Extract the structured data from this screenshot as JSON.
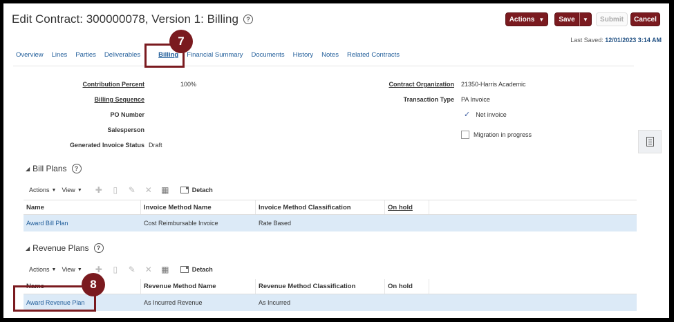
{
  "header": {
    "title": "Edit Contract: 300000078, Version 1: Billing",
    "actions_label": "Actions",
    "save_label": "Save",
    "submit_label": "Submit",
    "cancel_label": "Cancel",
    "last_saved_label": "Last Saved:",
    "last_saved_value": "12/01/2023 3:14 AM"
  },
  "tabs": [
    {
      "label": "Overview"
    },
    {
      "label": "Lines"
    },
    {
      "label": "Parties"
    },
    {
      "label": "Deliverables"
    },
    {
      "label": "Billing"
    },
    {
      "label": "Financial Summary"
    },
    {
      "label": "Documents"
    },
    {
      "label": "History"
    },
    {
      "label": "Notes"
    },
    {
      "label": "Related Contracts"
    }
  ],
  "form": {
    "contribution_percent_label": "Contribution Percent",
    "contribution_percent_value": "100%",
    "billing_sequence_label": "Billing Sequence",
    "po_number_label": "PO Number",
    "salesperson_label": "Salesperson",
    "generated_invoice_status_label": "Generated Invoice Status",
    "generated_invoice_status_value": "Draft",
    "contract_org_label": "Contract Organization",
    "contract_org_value": "21350-Harris Academic",
    "transaction_type_label": "Transaction Type",
    "transaction_type_value": "PA Invoice",
    "net_invoice_label": "Net invoice",
    "migration_label": "Migration in progress"
  },
  "bill_plans": {
    "title": "Bill Plans",
    "toolbar": {
      "actions": "Actions",
      "view": "View",
      "detach": "Detach"
    },
    "columns": [
      "Name",
      "Invoice Method Name",
      "Invoice Method Classification",
      "On hold"
    ],
    "rows": [
      {
        "name": "Award Bill Plan",
        "method": "Cost Reimbursable Invoice",
        "classification": "Rate Based",
        "on_hold": ""
      }
    ]
  },
  "revenue_plans": {
    "title": "Revenue Plans",
    "toolbar": {
      "actions": "Actions",
      "view": "View",
      "detach": "Detach"
    },
    "columns": [
      "Name",
      "Revenue Method Name",
      "Revenue Method Classification",
      "On hold"
    ],
    "rows": [
      {
        "name": "Award Revenue Plan",
        "method": "As Incurred Revenue",
        "classification": "As Incurred",
        "on_hold": ""
      }
    ]
  },
  "callouts": [
    {
      "number": "7"
    },
    {
      "number": "8"
    }
  ],
  "colors": {
    "brand": "#7a1a1f",
    "link": "#1f5c99",
    "row_selected": "#dceaf7"
  }
}
